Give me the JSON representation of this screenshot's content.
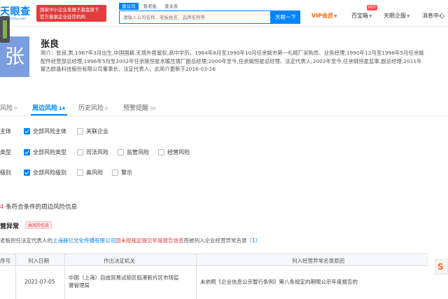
{
  "header": {
    "logo": {
      "main": "天眼查",
      "sub": "TianYanCha.com"
    },
    "promo": {
      "line1": "国家中小企业发展子基金旗下",
      "line2": "官方备案企业征信机构"
    },
    "search_tabs": [
      "查公司",
      "查老板",
      "查关系"
    ],
    "search_placeholder": "请输入公司名称、老板姓名、品牌名称等",
    "search_button": "天眼一下",
    "nav": {
      "vip": "VIP会员",
      "treasure": "百宝箱",
      "hot": "HOT",
      "enterprise": "天眼企服",
      "messages": "消息中心"
    }
  },
  "person": {
    "avatar_char": "张",
    "name": "张良",
    "bio_lines": [
      "简介：张良,男,1967年3月出生,中国国籍,无境外居留权,高中学历。1984年8月至1990年10月任余姚市第一礼砌厂采购员、业务经理;1990年12月至1996年5月任余姚",
      "配件经营部总经理;1996年5月至2002年任余姚恒星水暖压铸厂副总经理;2000年至今,任余姚恒星总经理、法定代表人;2002年至今,任余姚恒星监事,副总经理;2011年",
      "蒙古欧晶科技股份有限公司董事长、法定代表人。此简介更新于2016-03-16"
    ]
  },
  "risk_tabs": [
    {
      "label": "风险",
      "count": "0"
    },
    {
      "label": "周边风险",
      "count": "14"
    },
    {
      "label": "历史风险",
      "count": "0"
    },
    {
      "label": "预警提醒",
      "count": "30"
    }
  ],
  "filters": [
    {
      "label": "主体",
      "options": [
        {
          "text": "全部风险主体",
          "checked": true
        },
        {
          "text": "关联企业",
          "checked": false
        }
      ]
    },
    {
      "label": "类型",
      "options": [
        {
          "text": "全部风险类型",
          "checked": true
        },
        {
          "text": "司法风险",
          "checked": false
        },
        {
          "text": "监管风险",
          "checked": false
        },
        {
          "text": "经营风险",
          "checked": false
        }
      ]
    },
    {
      "label": "级别",
      "options": [
        {
          "text": "全部风险级别",
          "checked": true
        },
        {
          "text": "高风险",
          "checked": false
        },
        {
          "text": "警示",
          "checked": false
        }
      ]
    }
  ],
  "result": {
    "count": "4",
    "text": "条符合条件的周边风险信息"
  },
  "section": {
    "title": "营异常",
    "tag": "高风险信息",
    "desc": {
      "prefix": "老板担任法定代表人的",
      "company": "上海赫亿文化传播有限公司",
      "reason": "因未按规定提交年度报告信息",
      "suffix": "而被列入企业经营异常名录",
      "count": "（1）"
    }
  },
  "table": {
    "headers": [
      "序号",
      "列入日期",
      "作出决定机关",
      "列入经营异常名录原因"
    ],
    "rows": [
      {
        "date": "2021-07-05",
        "authority_line1": "中国（上海）自由贸易试验区临港新片区市场监",
        "authority_line2": "督管理局",
        "reason": "未依照《企业信息公示暂行条例》第八条规定的期限公示年度报告的"
      }
    ]
  },
  "float_button": "S"
}
